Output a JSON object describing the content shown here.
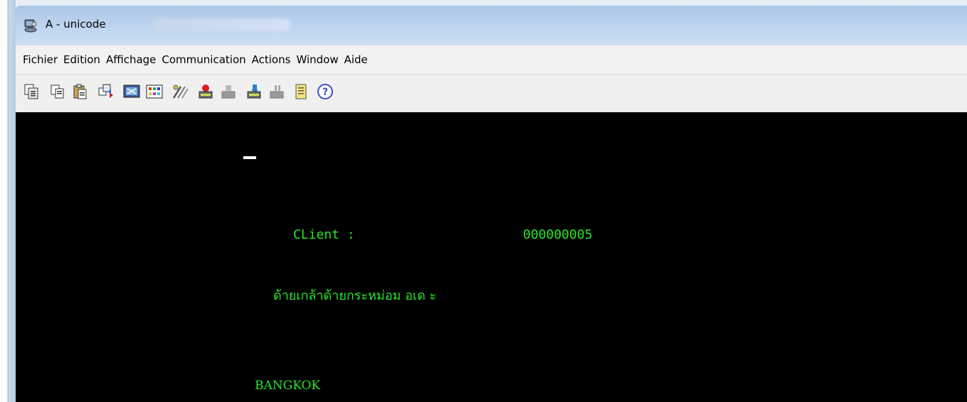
{
  "window": {
    "title": "A - unicode"
  },
  "menubar": {
    "items": [
      {
        "label": "Fichier"
      },
      {
        "label": "Edition"
      },
      {
        "label": "Affichage"
      },
      {
        "label": "Communication"
      },
      {
        "label": "Actions"
      },
      {
        "label": "Window"
      },
      {
        "label": "Aide"
      }
    ]
  },
  "toolbar": {
    "icons": [
      "copy-append-icon",
      "copy-icon",
      "paste-icon",
      "send-receive-icon",
      "display-setup-icon",
      "color-palette-icon",
      "macro-icon",
      "print-icon",
      "print-disabled-icon",
      "print-setup-icon",
      "print-setup-disabled-icon",
      "notes-icon",
      "help-icon"
    ]
  },
  "terminal": {
    "cursor": "_",
    "client_label": "CLient :",
    "client_value": "000000005",
    "thai_line": "ด้ายเกล้าด้ายกระหม่อม อเด ะ",
    "city": "BANGKOK",
    "background": "#000000",
    "text_color": "#26e626"
  }
}
